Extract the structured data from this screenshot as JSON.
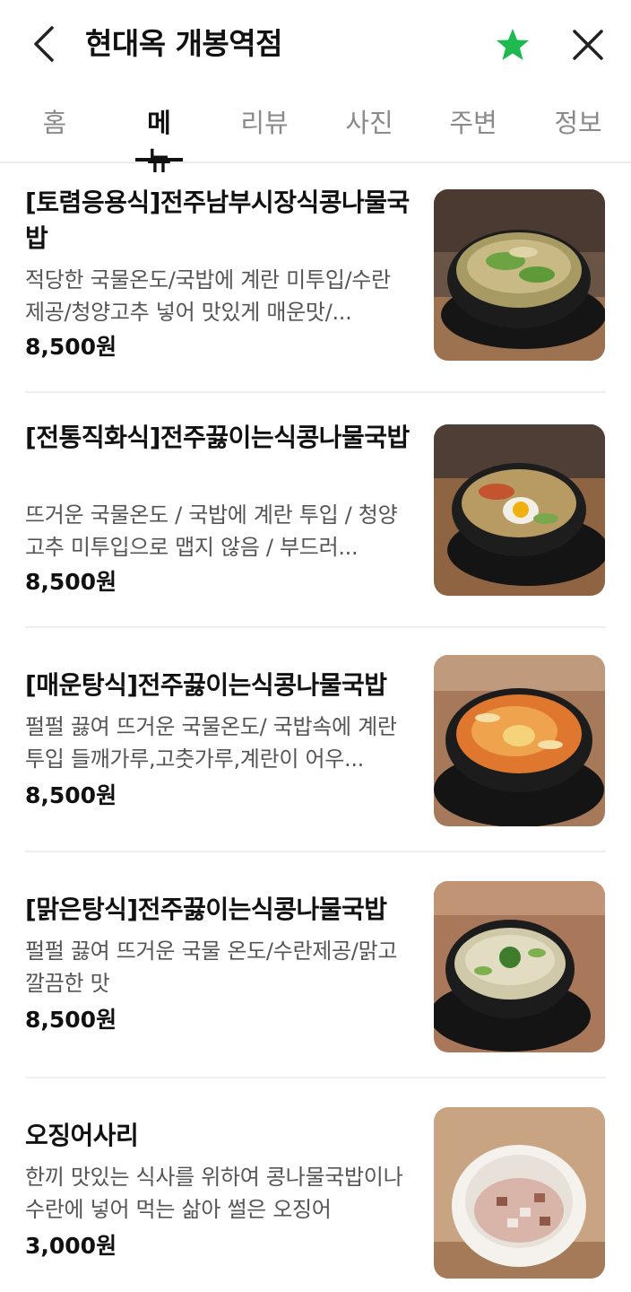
{
  "header": {
    "title": "현대옥 개봉역점",
    "favorite_color": "#1fba4f"
  },
  "tabs": [
    {
      "label": "홈"
    },
    {
      "label": "메뉴"
    },
    {
      "label": "리뷰"
    },
    {
      "label": "사진"
    },
    {
      "label": "주변"
    },
    {
      "label": "정보"
    }
  ],
  "active_tab": "메뉴",
  "menu": [
    {
      "name": "[토렴응용식]전주남부시장식콩나물국밥",
      "description": "적당한 국물온도/국밥에 계란 미투입/수란 제공/청양고추 넣어 맛있게 매운맛/...",
      "price": "8,500원"
    },
    {
      "name": "[전통직화식]전주끓이는식콩나물국밥",
      "description": "뜨거운 국물온도 / 국밥에 계란 투입 / 청양고추 미투입으로 맵지 않음 / 부드러...",
      "price": "8,500원"
    },
    {
      "name": "[매운탕식]전주끓이는식콩나물국밥",
      "description": "펄펄 끓여 뜨거운 국물온도/ 국밥속에 계란 투입 들깨가루,고춧가루,계란이 어우...",
      "price": "8,500원"
    },
    {
      "name": "[맑은탕식]전주끓이는식콩나물국밥",
      "description": "펄펄 끓여 뜨거운 국물 온도/수란제공/맑고 깔끔한 맛",
      "price": "8,500원"
    },
    {
      "name": "오징어사리",
      "description": "한끼 맛있는 식사를 위하여 콩나물국밥이나 수란에 넣어 먹는 삶아 썰은 오징어",
      "price": "3,000원"
    }
  ]
}
